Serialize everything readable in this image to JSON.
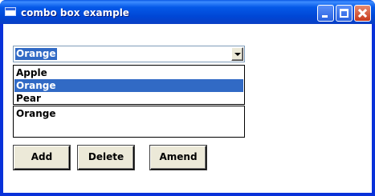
{
  "window": {
    "title": "combo box example",
    "controls": [
      "minimize-icon",
      "maximize-icon",
      "close-icon"
    ],
    "accent": "#0831d9"
  },
  "combo": {
    "selected": "Orange",
    "options": [
      "Apple",
      "Orange",
      "Pear"
    ],
    "highlighted_index": 1,
    "selection_color": "#316ac5"
  },
  "list": {
    "items": [
      "Orange"
    ]
  },
  "buttons": {
    "add": "Add",
    "delete": "Delete",
    "amend": "Amend"
  }
}
